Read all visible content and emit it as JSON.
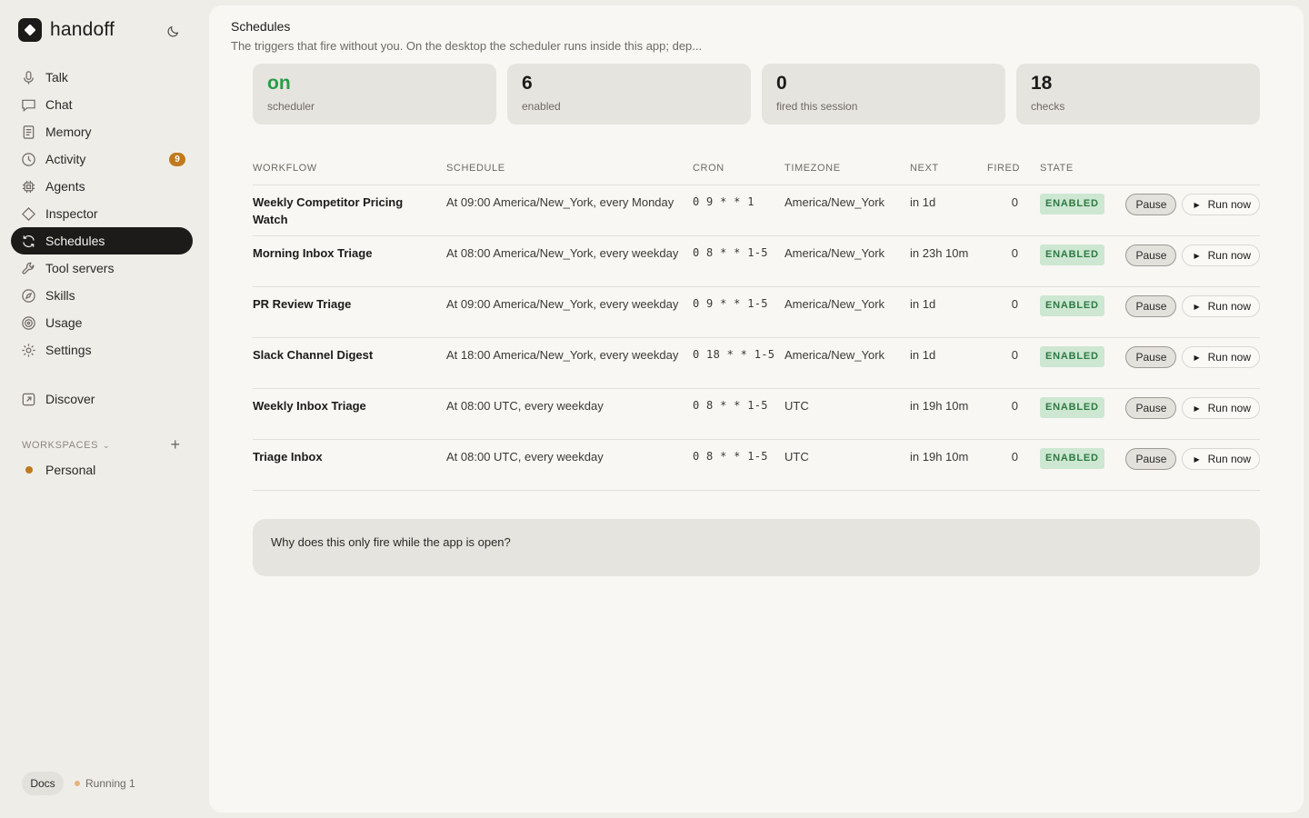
{
  "app": {
    "name": "handoff"
  },
  "nav": {
    "items": [
      {
        "label": "Talk",
        "icon": "mic-icon"
      },
      {
        "label": "Chat",
        "icon": "chat-icon"
      },
      {
        "label": "Memory",
        "icon": "document-icon"
      },
      {
        "label": "Activity",
        "icon": "clock-icon",
        "badge": "9"
      },
      {
        "label": "Agents",
        "icon": "cpu-icon"
      },
      {
        "label": "Inspector",
        "icon": "diamond-icon"
      },
      {
        "label": "Schedules",
        "icon": "refresh-icon",
        "active": true
      },
      {
        "label": "Tool servers",
        "icon": "wrench-icon"
      },
      {
        "label": "Skills",
        "icon": "compass-icon"
      },
      {
        "label": "Usage",
        "icon": "target-icon"
      },
      {
        "label": "Settings",
        "icon": "gear-icon"
      }
    ],
    "discover": "Discover"
  },
  "workspaces": {
    "header": "WORKSPACES",
    "items": [
      {
        "label": "Personal",
        "color": "#c07a1e"
      }
    ]
  },
  "footer": {
    "docs": "Docs",
    "running": "Running 1"
  },
  "page": {
    "title": "Schedules",
    "subtitle": "The triggers that fire without you. On the desktop the scheduler runs inside this app; dep..."
  },
  "stats": [
    {
      "value": "on",
      "label": "scheduler"
    },
    {
      "value": "6",
      "label": "enabled"
    },
    {
      "value": "0",
      "label": "fired this session"
    },
    {
      "value": "18",
      "label": "checks"
    }
  ],
  "table": {
    "headers": [
      "WORKFLOW",
      "SCHEDULE",
      "CRON",
      "TIMEZONE",
      "NEXT",
      "FIRED",
      "STATE"
    ],
    "pause_label": "Pause",
    "run_label": "Run now",
    "rows": [
      {
        "workflow": "Weekly Competitor Pricing Watch",
        "schedule": "At 09:00 America/New_York, every Monday",
        "cron": "0 9 * * 1",
        "timezone": "America/New_York",
        "next": "in 1d",
        "fired": "0",
        "state": "ENABLED"
      },
      {
        "workflow": "Morning Inbox Triage",
        "schedule": "At 08:00 America/New_York, every weekday",
        "cron": "0 8 * * 1-5",
        "timezone": "America/New_York",
        "next": "in 23h 10m",
        "fired": "0",
        "state": "ENABLED"
      },
      {
        "workflow": "PR Review Triage",
        "schedule": "At 09:00 America/New_York, every weekday",
        "cron": "0 9 * * 1-5",
        "timezone": "America/New_York",
        "next": "in 1d",
        "fired": "0",
        "state": "ENABLED"
      },
      {
        "workflow": "Slack Channel Digest",
        "schedule": "At 18:00 America/New_York, every weekday",
        "cron": "0 18 * * 1-5",
        "timezone": "America/New_York",
        "next": "in 1d",
        "fired": "0",
        "state": "ENABLED"
      },
      {
        "workflow": "Weekly Inbox Triage",
        "schedule": "At 08:00 UTC, every weekday",
        "cron": "0 8 * * 1-5",
        "timezone": "UTC",
        "next": "in 19h 10m",
        "fired": "0",
        "state": "ENABLED"
      },
      {
        "workflow": "Triage Inbox",
        "schedule": "At 08:00 UTC, every weekday",
        "cron": "0 8 * * 1-5",
        "timezone": "UTC",
        "next": "in 19h 10m",
        "fired": "0",
        "state": "ENABLED"
      }
    ]
  },
  "faq": {
    "question": "Why does this only fire while the app is open?"
  },
  "colors": {
    "accent": "#1c1b19",
    "badge": "#c07a1e",
    "enabled_bg": "#cde7d2",
    "enabled_text": "#2c7a41",
    "on_green": "#2a9b48"
  }
}
